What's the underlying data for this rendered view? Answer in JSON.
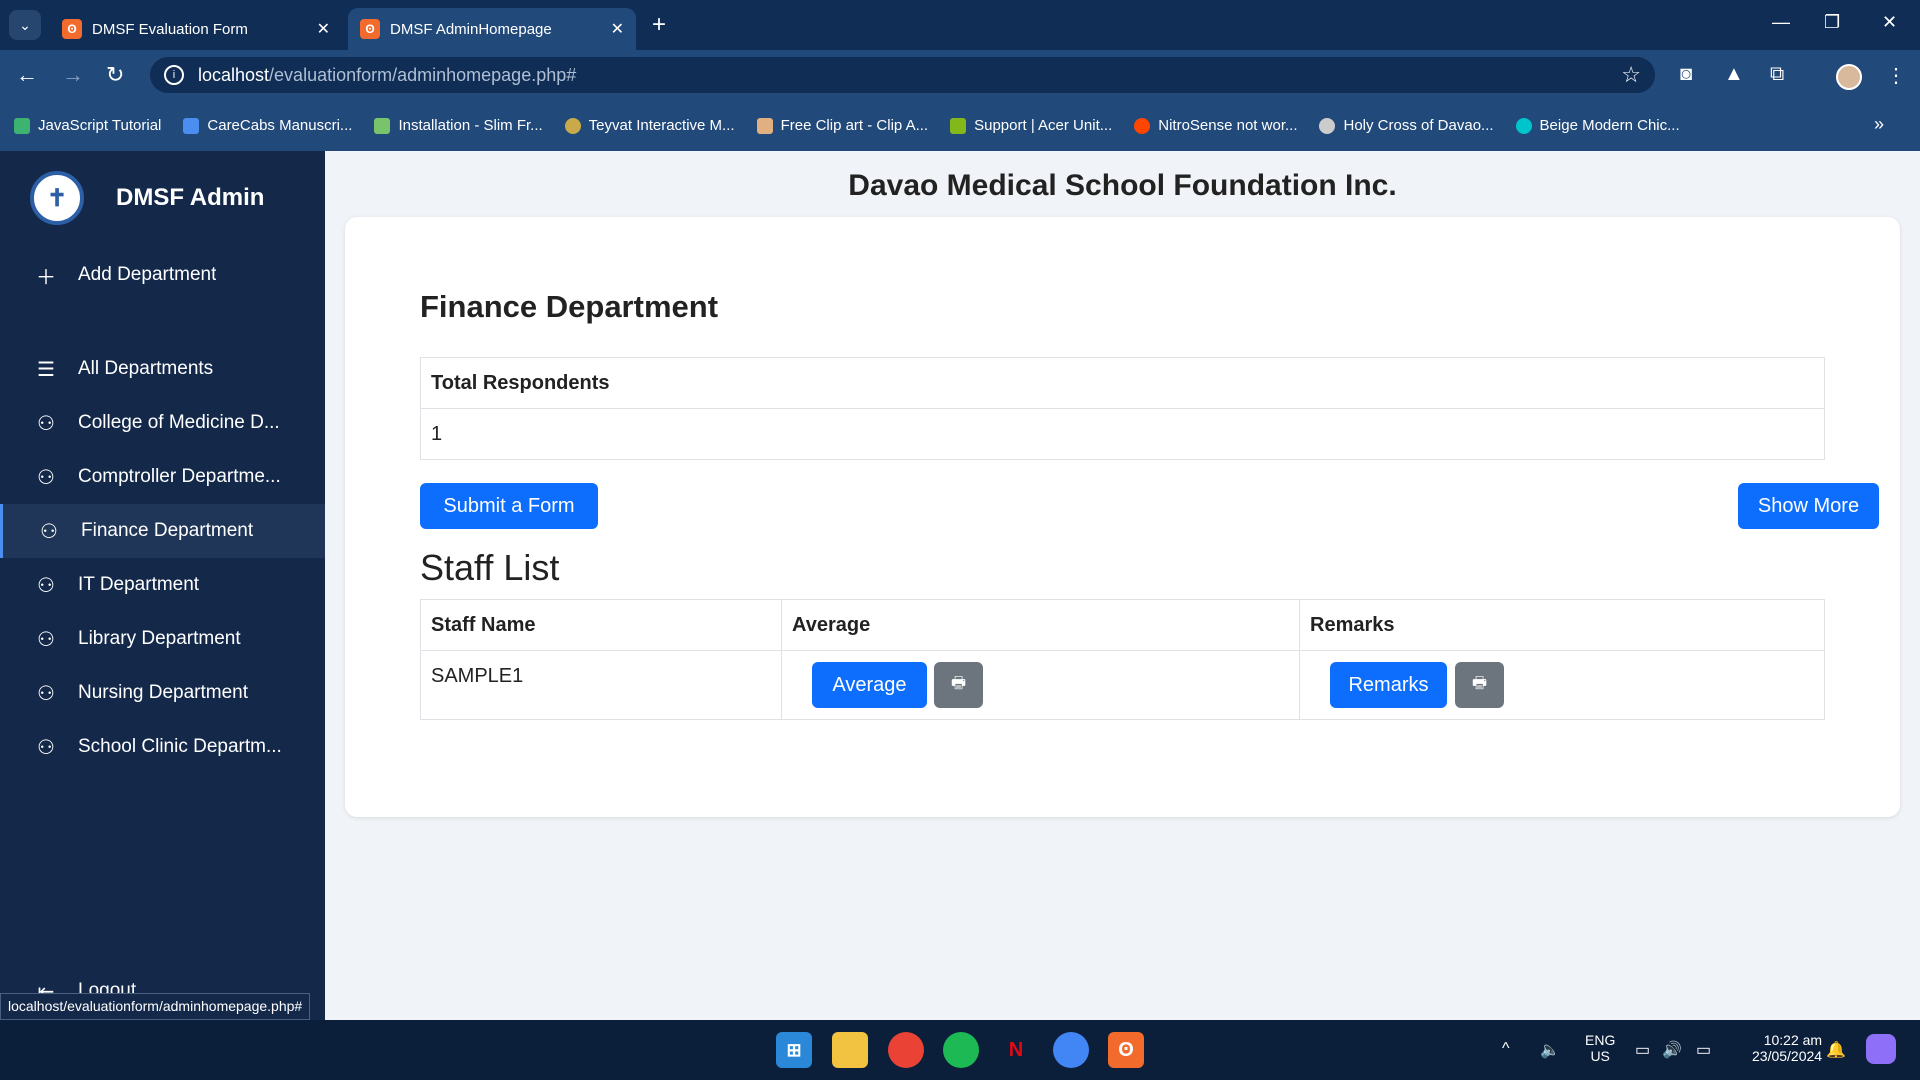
{
  "browser": {
    "tabs": [
      {
        "title": "DMSF Evaluation Form",
        "active": false
      },
      {
        "title": "DMSF AdminHomepage",
        "active": true
      }
    ],
    "url_host": "localhost",
    "url_path": "/evaluationform/adminhomepage.php#",
    "bookmarks": [
      {
        "label": "JavaScript Tutorial",
        "color": "#3cb371"
      },
      {
        "label": "CareCabs Manuscri...",
        "color": "#4a8ef0"
      },
      {
        "label": "Installation - Slim Fr...",
        "color": "#79c36a"
      },
      {
        "label": "Teyvat Interactive M...",
        "color": "#c9a94a"
      },
      {
        "label": "Free Clip art - Clip A...",
        "color": "#e0b080"
      },
      {
        "label": "Support | Acer Unit...",
        "color": "#83b81a"
      },
      {
        "label": "NitroSense not wor...",
        "color": "#ff4500"
      },
      {
        "label": "Holy Cross of Davao...",
        "color": "#cccccc"
      },
      {
        "label": "Beige Modern Chic...",
        "color": "#00c4cc"
      }
    ],
    "status_url": "localhost/evaluationform/adminhomepage.php#"
  },
  "sidebar": {
    "brand": "DMSF Admin",
    "add_label": "Add Department",
    "all_label": "All Departments",
    "items": [
      {
        "label": "College of Medicine D..."
      },
      {
        "label": "Comptroller Departme..."
      },
      {
        "label": "Finance Department",
        "active": true
      },
      {
        "label": "IT Department"
      },
      {
        "label": "Library Department"
      },
      {
        "label": "Nursing Department"
      },
      {
        "label": "School Clinic Departm..."
      }
    ],
    "logout_label": "Logout"
  },
  "main": {
    "org_title": "Davao Medical School Foundation Inc.",
    "dept_title": "Finance Department",
    "respondents_header": "Total Respondents",
    "respondents_value": "1",
    "submit_label": "Submit a Form",
    "show_more_label": "Show More",
    "staff_title": "Staff List",
    "staff_headers": [
      "Staff Name",
      "Average",
      "Remarks"
    ],
    "staff_rows": [
      {
        "name": "SAMPLE1",
        "average_label": "Average",
        "remarks_label": "Remarks"
      }
    ]
  },
  "taskbar": {
    "lang": "ENG",
    "region": "US",
    "time": "10:22 am",
    "date": "23/05/2024"
  }
}
